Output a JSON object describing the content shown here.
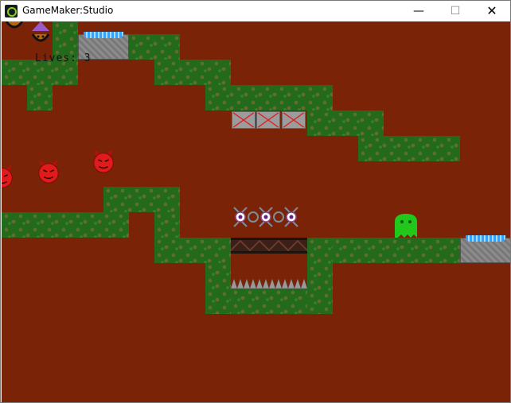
{
  "window": {
    "title": "GameMaker:Studio",
    "minimize_icon": "minimize-icon",
    "maximize_icon": "maximize-icon",
    "close_icon": "close-icon"
  },
  "hud": {
    "lives_text": "Lives: 3"
  },
  "colors": {
    "background": "#7a2306",
    "grass": "#246a1d",
    "devil": "#e01b1b",
    "ghost": "#22c71c",
    "spring": "#2fa4ff"
  }
}
